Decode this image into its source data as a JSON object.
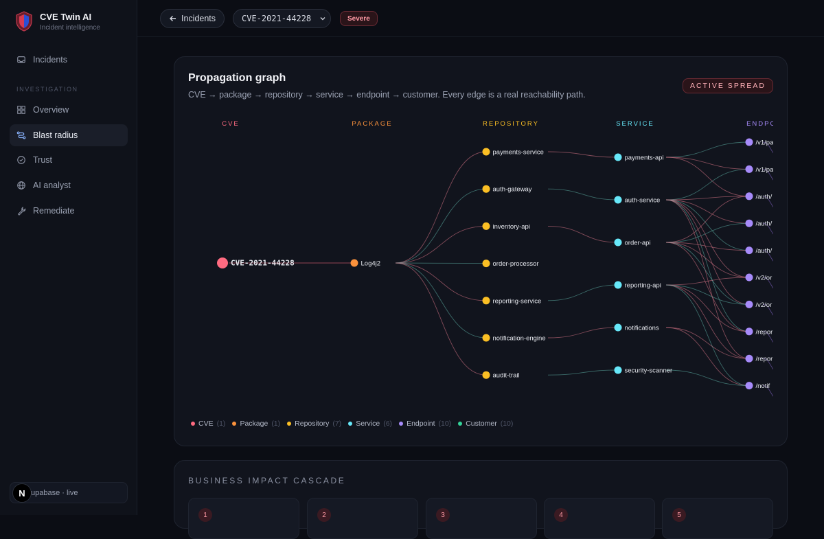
{
  "brand": {
    "title": "CVE Twin AI",
    "subtitle": "Incident intelligence"
  },
  "sidebar": {
    "top_item": {
      "label": "Incidents",
      "icon": "inbox-icon"
    },
    "section": "INVESTIGATION",
    "items": [
      {
        "label": "Overview",
        "icon": "grid-icon",
        "active": false
      },
      {
        "label": "Blast radius",
        "icon": "route-icon",
        "active": true
      },
      {
        "label": "Trust",
        "icon": "check-circle-icon",
        "active": false
      },
      {
        "label": "AI analyst",
        "icon": "globe-icon",
        "active": false
      },
      {
        "label": "Remediate",
        "icon": "wrench-icon",
        "active": false
      }
    ],
    "status": "upabase · live",
    "badge": "N"
  },
  "topbar": {
    "back_label": "Incidents",
    "cve_id": "CVE-2021-44228",
    "severity": "Severe"
  },
  "graph_card": {
    "title": "Propagation graph",
    "description": "CVE → package → repository → service → endpoint → customer. Every edge is a real reachability path.",
    "status_badge": "ACTIVE SPREAD"
  },
  "colors": {
    "cve": "#ff6b81",
    "package": "#fb923c",
    "repository": "#fbbf24",
    "service": "#67e8f9",
    "endpoint": "#a78bfa",
    "customer": "#34d399"
  },
  "chart_data": {
    "type": "network",
    "columns": [
      {
        "key": "cve",
        "label": "CVE"
      },
      {
        "key": "package",
        "label": "PACKAGE"
      },
      {
        "key": "repository",
        "label": "REPOSITORY"
      },
      {
        "key": "service",
        "label": "SERVICE"
      },
      {
        "key": "endpoint",
        "label": "ENDPO"
      }
    ],
    "nodes": {
      "cve": [
        "CVE-2021-44228"
      ],
      "package": [
        "Log4j2"
      ],
      "repository": [
        "payments-service",
        "auth-gateway",
        "inventory-api",
        "order-processor",
        "reporting-service",
        "notification-engine",
        "audit-trail"
      ],
      "service": [
        "payments-api",
        "auth-service",
        "order-api",
        "reporting-api",
        "notifications",
        "security-scanner"
      ],
      "endpoint": [
        "/v1/pa",
        "/v1/pa",
        "/auth/",
        "/auth/",
        "/auth/",
        "/v2/or",
        "/v2/or",
        "/repor",
        "/repor",
        "/notif"
      ]
    },
    "edges": {
      "repository_to_service": [
        [
          0,
          0
        ],
        [
          1,
          1
        ],
        [
          2,
          2
        ],
        [
          4,
          3
        ],
        [
          5,
          4
        ],
        [
          6,
          5
        ]
      ],
      "service_to_endpoint": [
        [
          0,
          0
        ],
        [
          0,
          1
        ],
        [
          0,
          2
        ],
        [
          1,
          1
        ],
        [
          1,
          2
        ],
        [
          1,
          3
        ],
        [
          1,
          4
        ],
        [
          1,
          5
        ],
        [
          1,
          6
        ],
        [
          1,
          7
        ],
        [
          1,
          8
        ],
        [
          2,
          2
        ],
        [
          2,
          3
        ],
        [
          2,
          4
        ],
        [
          2,
          5
        ],
        [
          2,
          6
        ],
        [
          2,
          7
        ],
        [
          3,
          5
        ],
        [
          3,
          6
        ],
        [
          3,
          7
        ],
        [
          3,
          8
        ],
        [
          3,
          9
        ],
        [
          4,
          8
        ],
        [
          4,
          9
        ],
        [
          5,
          9
        ]
      ]
    },
    "legend": [
      {
        "name": "CVE",
        "count": "(1)",
        "key": "cve"
      },
      {
        "name": "Package",
        "count": "(1)",
        "key": "package"
      },
      {
        "name": "Repository",
        "count": "(7)",
        "key": "repository"
      },
      {
        "name": "Service",
        "count": "(6)",
        "key": "service"
      },
      {
        "name": "Endpoint",
        "count": "(10)",
        "key": "endpoint"
      },
      {
        "name": "Customer",
        "count": "(10)",
        "key": "customer"
      }
    ]
  },
  "impact_card": {
    "title": "BUSINESS IMPACT CASCADE",
    "steps": [
      "1",
      "2",
      "3",
      "4",
      "5"
    ]
  }
}
